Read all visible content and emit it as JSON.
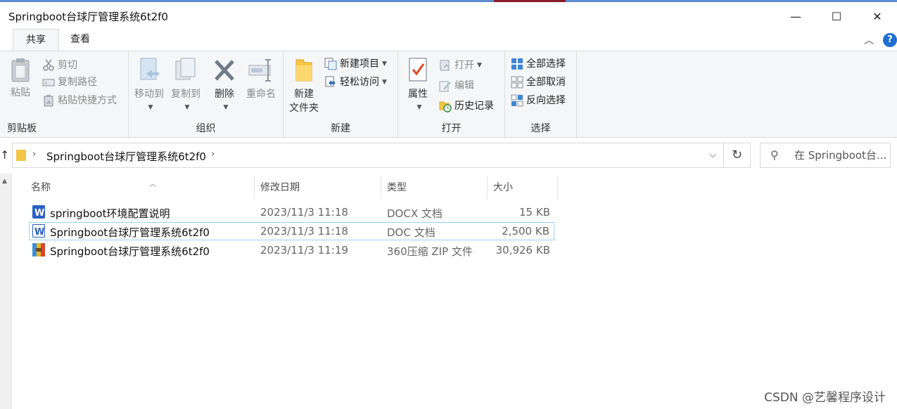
{
  "window": {
    "title": "Springboot台球厅管理系统6t2f0",
    "minimize_glyph": "—",
    "maximize_glyph": "☐",
    "close_glyph": "✕"
  },
  "ribbon_tabs": [
    {
      "label": "共享"
    },
    {
      "label": "查看"
    }
  ],
  "help_label": "?",
  "ribbon": {
    "clipboard": {
      "label": "剪贴板",
      "paste": "粘贴",
      "cut": "剪切",
      "copy_path": "复制路径",
      "paste_shortcut": "粘贴快捷方式"
    },
    "organize": {
      "label": "组织",
      "move_to": "移动到",
      "copy_to": "复制到",
      "delete": "删除",
      "rename": "重命名"
    },
    "new": {
      "label": "新建",
      "new_folder_line1": "新建",
      "new_folder_line2": "文件夹",
      "new_item": "新建项目",
      "easy_access": "轻松访问"
    },
    "open": {
      "label": "打开",
      "properties": "属性",
      "open": "打开",
      "edit": "编辑",
      "history": "历史记录"
    },
    "select": {
      "label": "选择",
      "select_all": "全部选择",
      "select_none": "全部取消",
      "invert": "反向选择"
    }
  },
  "address": {
    "path": "Springboot台球厅管理系统6t2f0",
    "search_placeholder": "在 Springboot台..."
  },
  "columns": {
    "name": "名称",
    "modified": "修改日期",
    "type": "类型",
    "size": "大小"
  },
  "files": [
    {
      "name": "springboot环境配置说明",
      "modified": "2023/11/3 11:18",
      "type": "DOCX 文档",
      "size": "15 KB",
      "icon": "word-icon"
    },
    {
      "name": "Springboot台球厅管理系统6t2f0",
      "modified": "2023/11/3 11:18",
      "type": "DOC 文档",
      "size": "2,500 KB",
      "icon": "word-icon"
    },
    {
      "name": "Springboot台球厅管理系统6t2f0",
      "modified": "2023/11/3 11:19",
      "type": "360压缩 ZIP 文件",
      "size": "30,926 KB",
      "icon": "zip-archive-icon"
    }
  ],
  "watermark": "CSDN @艺馨程序设计",
  "colors": {
    "accent": "#1e6fd0",
    "selection_border": "#99d1ff",
    "ribbon_bg": "#f5f6f7"
  }
}
